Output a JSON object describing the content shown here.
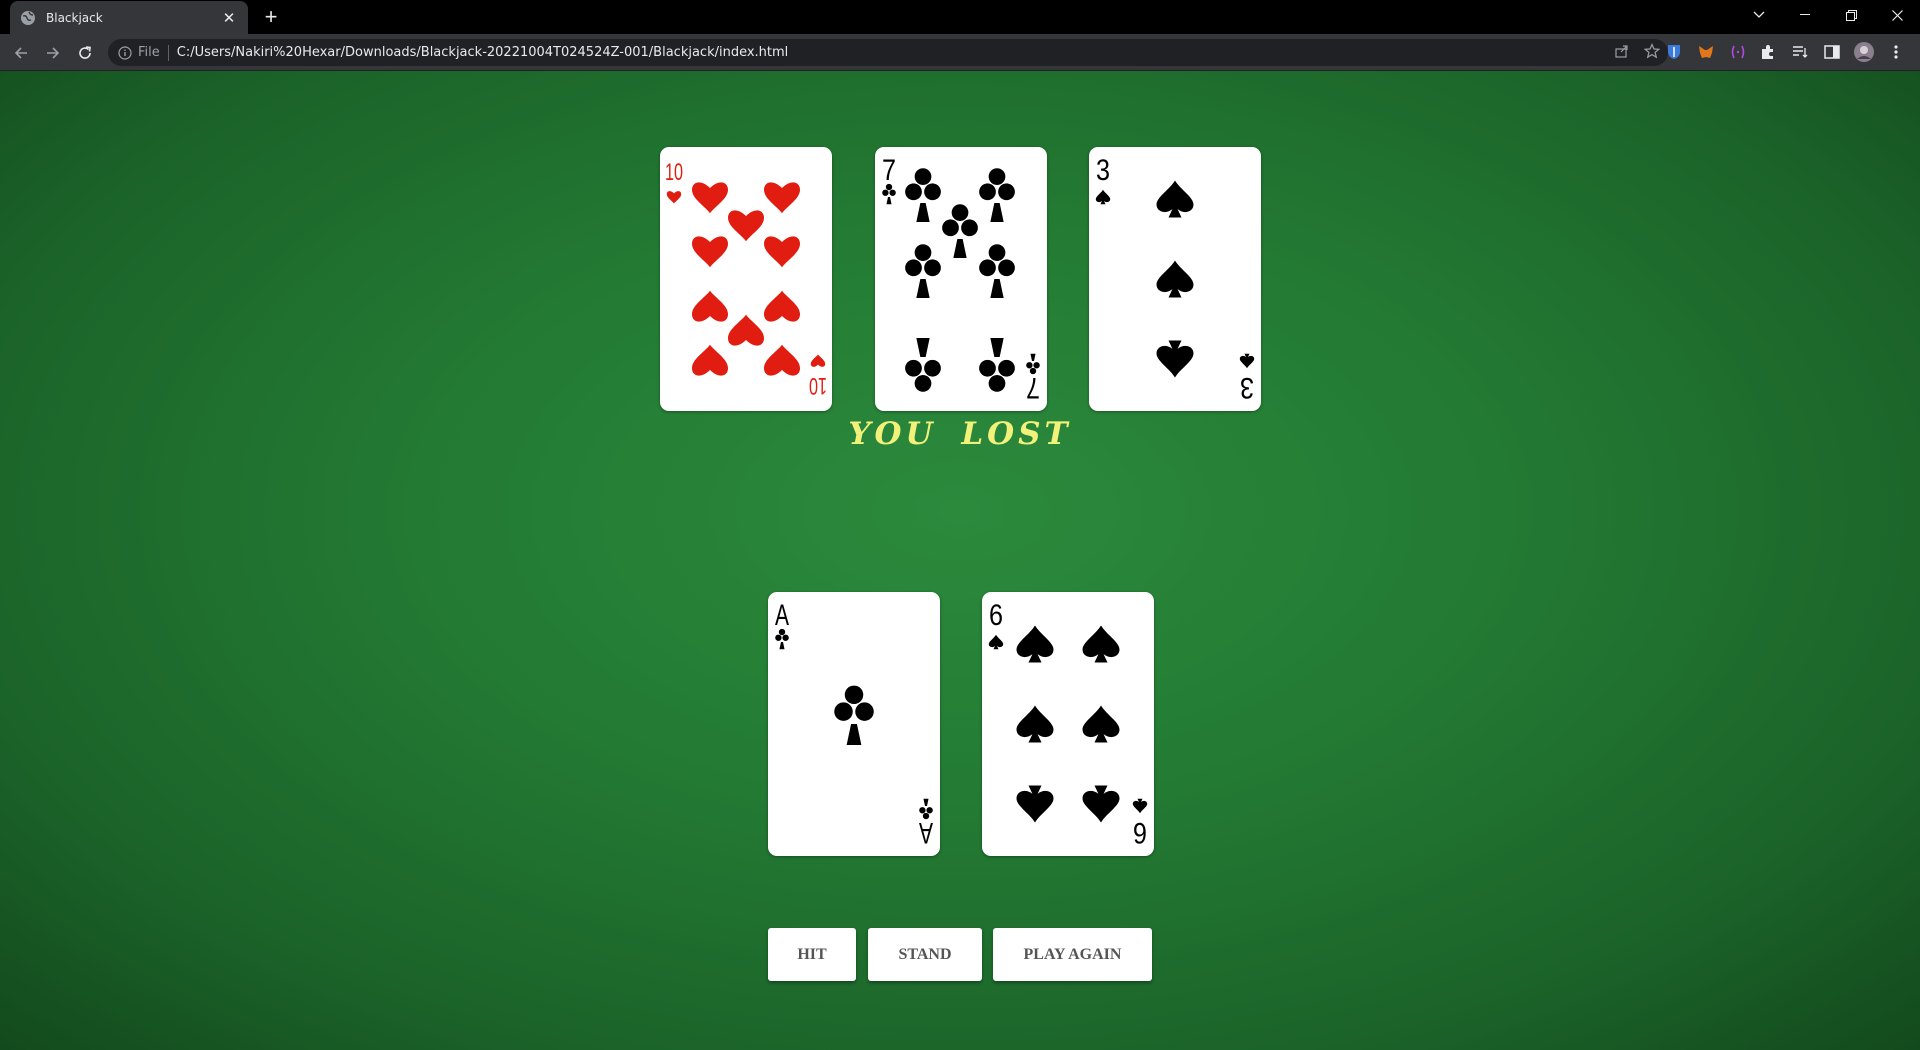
{
  "browser": {
    "tab_title": "Blackjack",
    "omnibox_scheme": "File",
    "url": "C:/Users/Nakiri%20Hexar/Downloads/Blackjack-20221004T024524Z-001/Blackjack/index.html"
  },
  "game": {
    "dealer_cards": [
      {
        "rank": "10",
        "suit": "hearts"
      },
      {
        "rank": "7",
        "suit": "clubs"
      },
      {
        "rank": "3",
        "suit": "spades"
      }
    ],
    "result_text": "YOU  LOST",
    "player_cards": [
      {
        "rank": "A",
        "suit": "clubs"
      },
      {
        "rank": "6",
        "suit": "spades"
      }
    ],
    "buttons": {
      "hit": "HIT",
      "stand": "STAND",
      "play_again": "PLAY AGAIN"
    }
  },
  "colors": {
    "felt": "#237a33",
    "result_text": "#f2f27a",
    "red_suit": "#e01d10",
    "black_suit": "#000000"
  }
}
